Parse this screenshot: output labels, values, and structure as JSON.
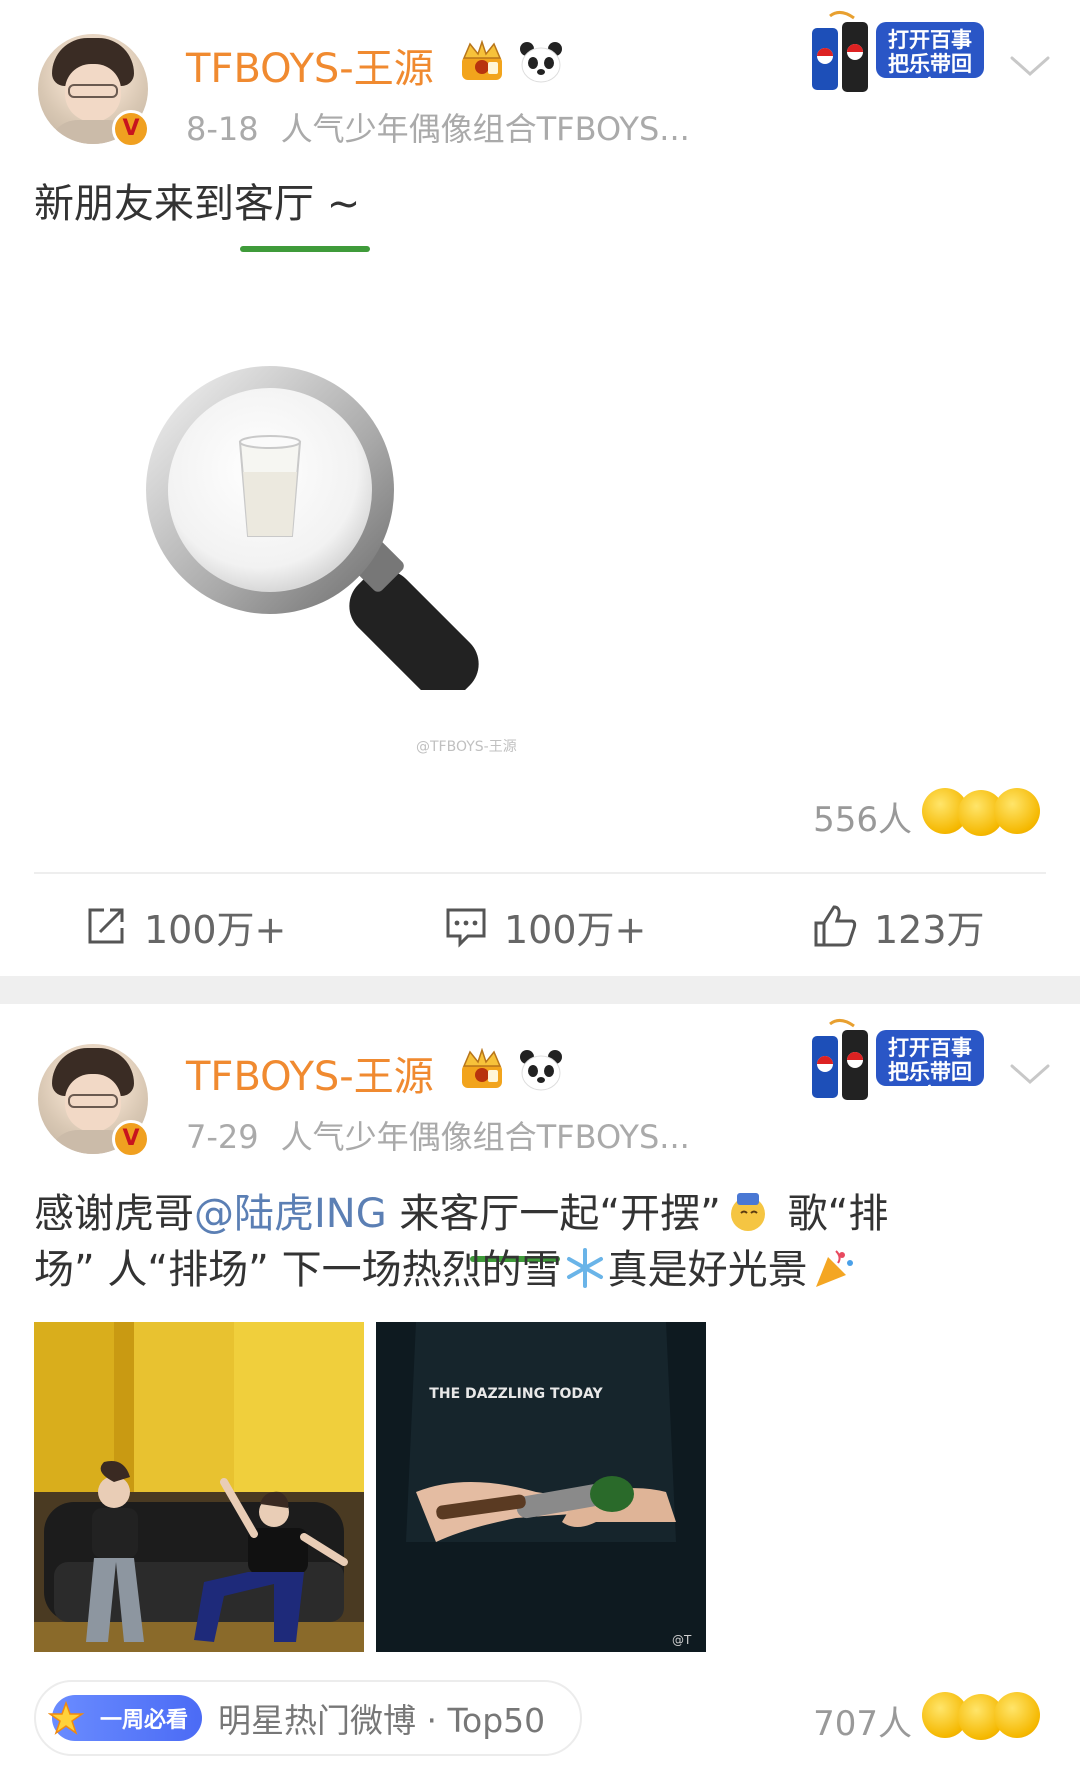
{
  "posts": [
    {
      "username": "TFBOYS-王源",
      "date": "8-18",
      "source": "人气少年偶像组合TFBOYS...",
      "ad_text_line1": "打开百事",
      "ad_text_line2": "把乐带回家",
      "text": "新朋友来到客厅 ~",
      "image_caption": "@TFBOYS-王源",
      "reaction_count": "556人",
      "share_count": "100万+",
      "comment_count": "100万+",
      "like_count": "123万"
    },
    {
      "username": "TFBOYS-王源",
      "date": "7-29",
      "source": "人气少年偶像组合TFBOYS...",
      "ad_text_line1": "打开百事",
      "ad_text_line2": "把乐带回家",
      "text_part1": "感谢虎哥",
      "mention": "@陆虎ING",
      "text_part2": " 来客厅一起“开摆”",
      "text_part3": " 歌“排",
      "text_line2a": "场” 人“排场” 下一场热烈的雪",
      "text_line2b": "真是好光景",
      "photo2_text": "THE DAZZLING TODAY",
      "photo2_watermark": "@T",
      "weekly_badge": "一周必看",
      "weekly_text": "明星热门微博 · Top50",
      "reaction_count": "707人"
    }
  ],
  "colors": {
    "username": "#f08a30",
    "mention": "#5b7fb4",
    "underline": "#3f9b3a",
    "meta": "#aaaaaa"
  },
  "icons": [
    "crown-icon",
    "panda-icon",
    "chevron-down-icon",
    "share-icon",
    "comment-icon",
    "like-icon",
    "snowflake-icon",
    "party-popper-icon",
    "magnifier-emoji"
  ]
}
